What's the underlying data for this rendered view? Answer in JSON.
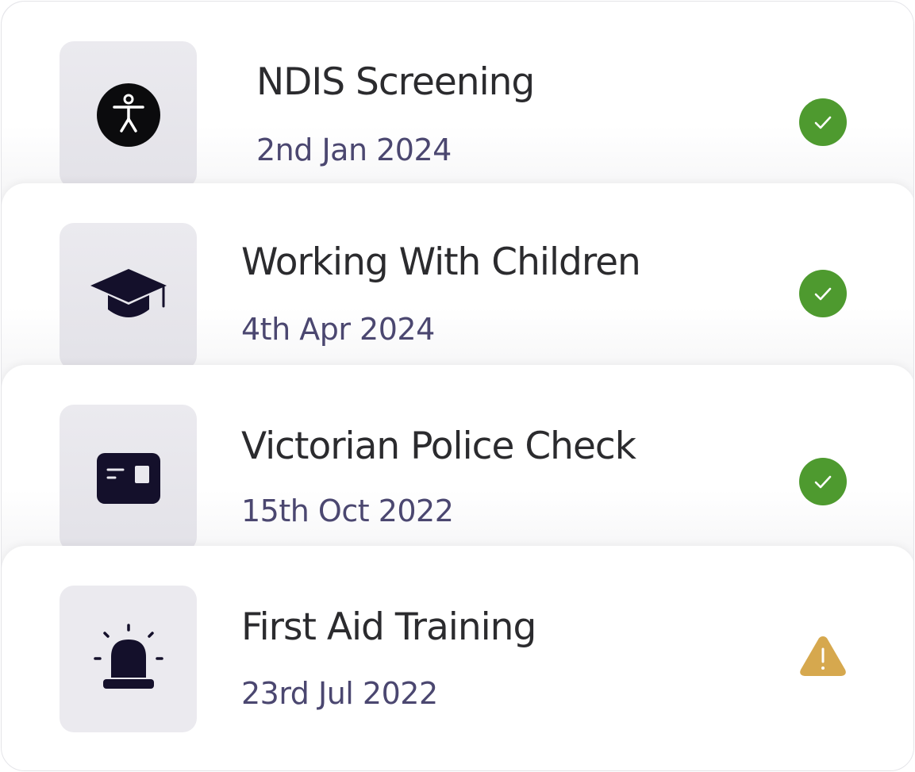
{
  "colors": {
    "success": "#4e9a2f",
    "warning": "#d6a84e",
    "icon_dark": "#14102b",
    "title_text": "#2b2b2e",
    "date_text": "#4b4770"
  },
  "items": [
    {
      "title": "NDIS Screening",
      "date": "2nd Jan 2024",
      "icon": "accessibility-icon",
      "status": "complete"
    },
    {
      "title": "Working With Children",
      "date": "4th Apr 2024",
      "icon": "graduation-cap-icon",
      "status": "complete"
    },
    {
      "title": "Victorian Police Check",
      "date": "15th Oct 2022",
      "icon": "id-card-icon",
      "status": "complete"
    },
    {
      "title": "First Aid Training",
      "date": "23rd Jul 2022",
      "icon": "emergency-siren-icon",
      "status": "warning"
    }
  ]
}
